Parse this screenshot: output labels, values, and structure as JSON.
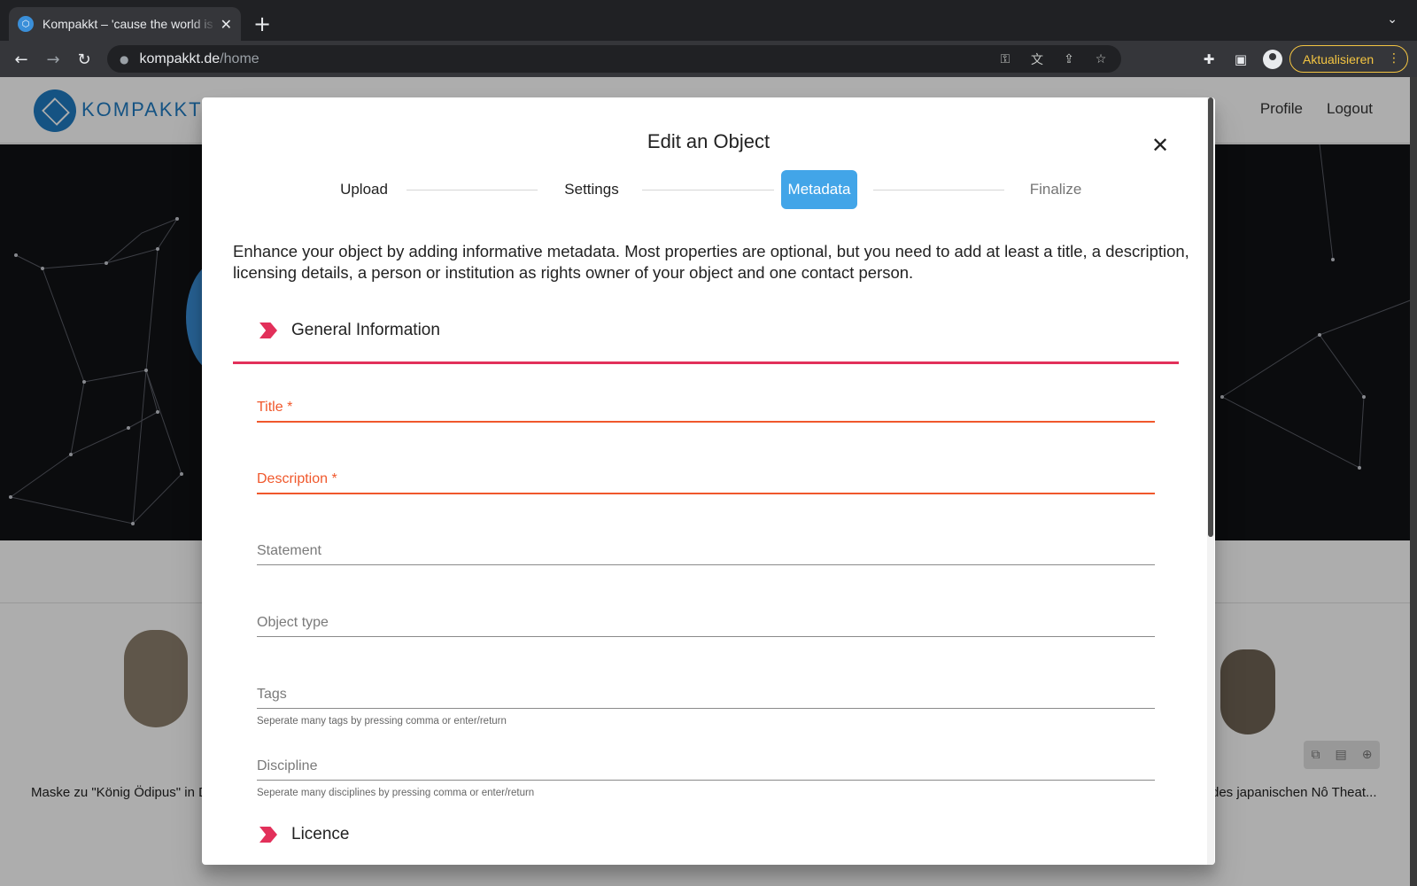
{
  "browser": {
    "tab_title": "Kompakkt – 'cause the world is not flat",
    "tab_close": "✕",
    "new_tab": "+",
    "tab_menu": "⌄",
    "back": "←",
    "forward": "→",
    "reload": "↻",
    "lock": "🔒",
    "url_host": "kompakkt.de",
    "url_path": "/home",
    "update_label": "Aktualisieren",
    "update_dots": "⋮",
    "omni_icons": [
      "key-icon",
      "translate-icon",
      "share-icon",
      "star-icon"
    ],
    "toolbar_icons": [
      "extensions-icon",
      "side-panel-icon",
      "profile-icon"
    ]
  },
  "site": {
    "logo_text": "KOMPAKKT",
    "nav": {
      "profile": "Profile",
      "logout": "Logout"
    },
    "caption_left": "Maske zu \"König Ödipus\" in D",
    "caption_right": "des japanischen Nô Theat...",
    "card_tools": [
      "⧉",
      "▤",
      "⊕"
    ]
  },
  "dialog": {
    "title": "Edit an Object",
    "close": "✕",
    "steps": {
      "upload": "Upload",
      "settings": "Settings",
      "metadata": "Metadata",
      "finalize": "Finalize"
    },
    "active_step": "Metadata",
    "intro": "Enhance your object by adding informative metadata. Most properties are optional, but you need to add at least a title, a description, licensing details, a person or institution as rights owner of your object and one contact person.",
    "sections": {
      "general": "General Information",
      "licence": "Licence"
    },
    "fields": {
      "title": {
        "label": "Title *",
        "value": ""
      },
      "description": {
        "label": "Description *",
        "value": ""
      },
      "statement": {
        "label": "Statement",
        "value": ""
      },
      "object_type": {
        "label": "Object type",
        "value": ""
      },
      "tags": {
        "label": "Tags",
        "value": "",
        "hint": "Seperate many tags by pressing comma or enter/return"
      },
      "discipline": {
        "label": "Discipline",
        "value": "",
        "hint": "Seperate many disciplines by pressing comma or enter/return"
      }
    }
  },
  "colors": {
    "accent": "#e2305a",
    "active_step": "#42a5e8",
    "error": "#f0582c",
    "brand": "#1f7bc2",
    "update": "#f4c542"
  }
}
